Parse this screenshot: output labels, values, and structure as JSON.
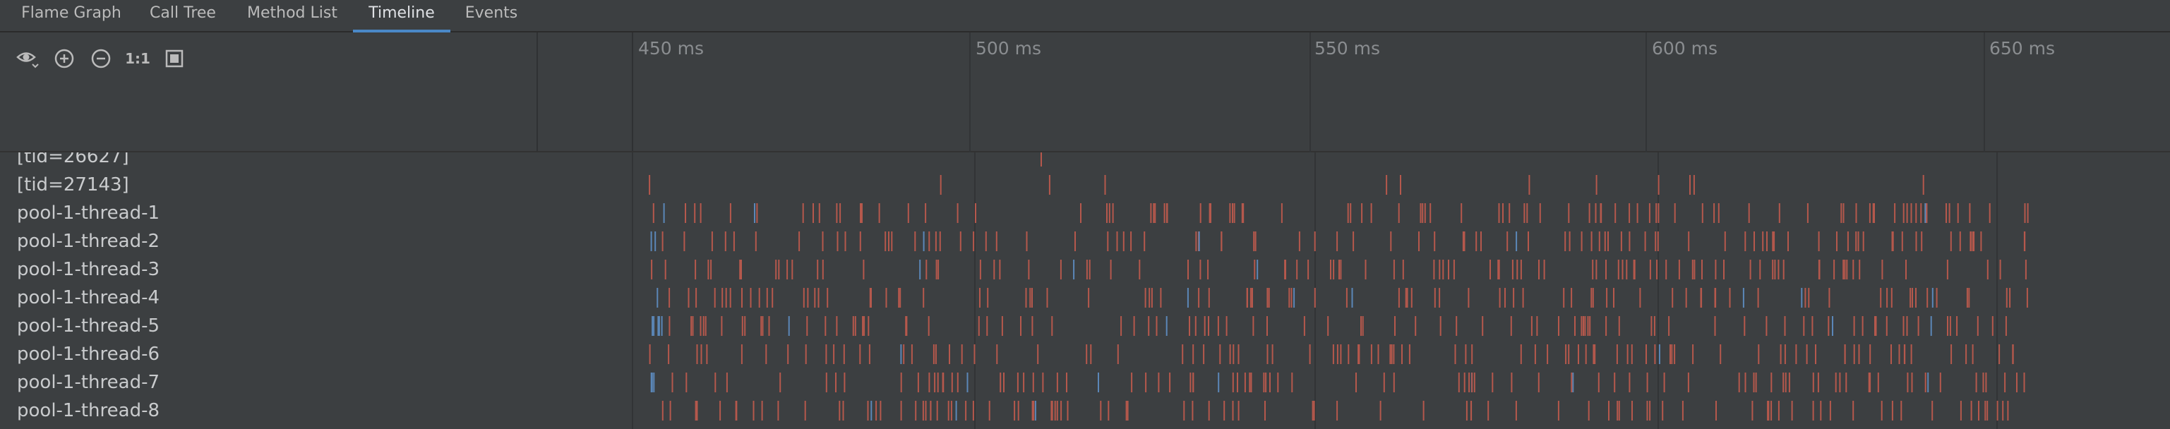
{
  "tabs": [
    {
      "label": "Flame Graph",
      "active": false
    },
    {
      "label": "Call Tree",
      "active": false
    },
    {
      "label": "Method List",
      "active": false
    },
    {
      "label": "Timeline",
      "active": true
    },
    {
      "label": "Events",
      "active": false
    }
  ],
  "toolbar": {
    "visibility": "eye-icon",
    "zoom_in": "zoom-in-icon",
    "zoom_out": "zoom-out-icon",
    "actual_size_label": "1:1",
    "fit": "fit-to-screen-icon"
  },
  "timeline": {
    "ticks": [
      "450 ms",
      "500 ms",
      "550 ms",
      "600 ms",
      "650 ms"
    ]
  },
  "threads": [
    "[tid=26627]",
    "[tid=27143]",
    "pool-1-thread-1",
    "pool-1-thread-2",
    "pool-1-thread-3",
    "pool-1-thread-4",
    "pool-1-thread-5",
    "pool-1-thread-6",
    "pool-1-thread-7",
    "pool-1-thread-8"
  ],
  "colors": {
    "background": "#3c3f41",
    "accent": "#4a88c7",
    "sample_red": "#b5584c",
    "sample_blue": "#5b87b8"
  }
}
